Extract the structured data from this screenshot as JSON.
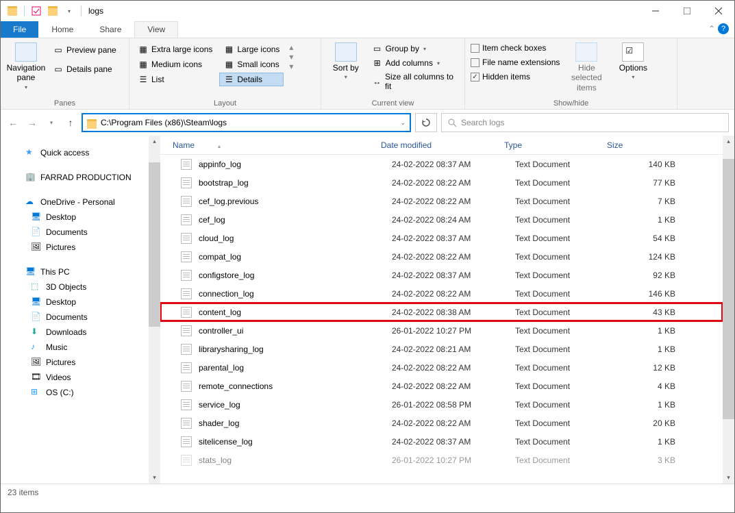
{
  "window": {
    "title": "logs"
  },
  "menubar": {
    "file": "File",
    "home": "Home",
    "share": "Share",
    "view": "View"
  },
  "ribbon": {
    "panes": {
      "navigation": "Navigation pane",
      "preview": "Preview pane",
      "details": "Details pane",
      "group": "Panes"
    },
    "layout": {
      "extra_large": "Extra large icons",
      "large": "Large icons",
      "medium": "Medium icons",
      "small": "Small icons",
      "list": "List",
      "details": "Details",
      "group": "Layout"
    },
    "currentview": {
      "sort_by": "Sort by",
      "group_by": "Group by",
      "add_columns": "Add columns",
      "size_columns": "Size all columns to fit",
      "group": "Current view"
    },
    "showhide": {
      "item_check": "Item check boxes",
      "file_ext": "File name extensions",
      "hidden": "Hidden items",
      "hide_selected": "Hide selected items",
      "options": "Options",
      "group": "Show/hide"
    }
  },
  "address": {
    "path": "C:\\Program Files (x86)\\Steam\\logs",
    "search_placeholder": "Search logs"
  },
  "sidebar": {
    "quick_access": "Quick access",
    "farrad": "FARRAD PRODUCTION",
    "onedrive": "OneDrive - Personal",
    "od_desktop": "Desktop",
    "od_documents": "Documents",
    "od_pictures": "Pictures",
    "this_pc": "This PC",
    "pc_3d": "3D Objects",
    "pc_desktop": "Desktop",
    "pc_documents": "Documents",
    "pc_downloads": "Downloads",
    "pc_music": "Music",
    "pc_pictures": "Pictures",
    "pc_videos": "Videos",
    "pc_os": "OS (C:)"
  },
  "columns": {
    "name": "Name",
    "date": "Date modified",
    "type": "Type",
    "size": "Size"
  },
  "files": [
    {
      "name": "appinfo_log",
      "date": "24-02-2022 08:37 AM",
      "type": "Text Document",
      "size": "140 KB",
      "hl": false
    },
    {
      "name": "bootstrap_log",
      "date": "24-02-2022 08:22 AM",
      "type": "Text Document",
      "size": "77 KB",
      "hl": false
    },
    {
      "name": "cef_log.previous",
      "date": "24-02-2022 08:22 AM",
      "type": "Text Document",
      "size": "7 KB",
      "hl": false
    },
    {
      "name": "cef_log",
      "date": "24-02-2022 08:24 AM",
      "type": "Text Document",
      "size": "1 KB",
      "hl": false
    },
    {
      "name": "cloud_log",
      "date": "24-02-2022 08:37 AM",
      "type": "Text Document",
      "size": "54 KB",
      "hl": false
    },
    {
      "name": "compat_log",
      "date": "24-02-2022 08:22 AM",
      "type": "Text Document",
      "size": "124 KB",
      "hl": false
    },
    {
      "name": "configstore_log",
      "date": "24-02-2022 08:37 AM",
      "type": "Text Document",
      "size": "92 KB",
      "hl": false
    },
    {
      "name": "connection_log",
      "date": "24-02-2022 08:22 AM",
      "type": "Text Document",
      "size": "146 KB",
      "hl": false
    },
    {
      "name": "content_log",
      "date": "24-02-2022 08:38 AM",
      "type": "Text Document",
      "size": "43 KB",
      "hl": true
    },
    {
      "name": "controller_ui",
      "date": "26-01-2022 10:27 PM",
      "type": "Text Document",
      "size": "1 KB",
      "hl": false
    },
    {
      "name": "librarysharing_log",
      "date": "24-02-2022 08:21 AM",
      "type": "Text Document",
      "size": "1 KB",
      "hl": false
    },
    {
      "name": "parental_log",
      "date": "24-02-2022 08:22 AM",
      "type": "Text Document",
      "size": "12 KB",
      "hl": false
    },
    {
      "name": "remote_connections",
      "date": "24-02-2022 08:22 AM",
      "type": "Text Document",
      "size": "4 KB",
      "hl": false
    },
    {
      "name": "service_log",
      "date": "26-01-2022 08:58 PM",
      "type": "Text Document",
      "size": "1 KB",
      "hl": false
    },
    {
      "name": "shader_log",
      "date": "24-02-2022 08:22 AM",
      "type": "Text Document",
      "size": "20 KB",
      "hl": false
    },
    {
      "name": "sitelicense_log",
      "date": "24-02-2022 08:37 AM",
      "type": "Text Document",
      "size": "1 KB",
      "hl": false
    },
    {
      "name": "stats_log",
      "date": "26-01-2022 10:27 PM",
      "type": "Text Document",
      "size": "3 KB",
      "hl": false
    }
  ],
  "status": {
    "count": "23 items"
  }
}
